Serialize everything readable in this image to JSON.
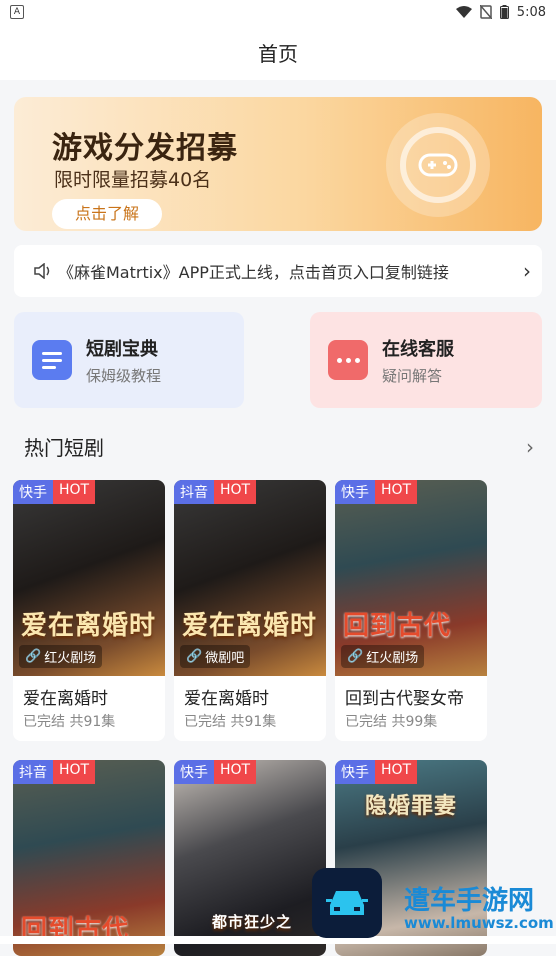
{
  "status_bar": {
    "left_icon": "A",
    "time": "5:08"
  },
  "header": {
    "title": "首页"
  },
  "banner": {
    "title": "游戏分发招募",
    "subtitle": "限时限量招募40名",
    "cta": "点击了解"
  },
  "notice": {
    "text": "《麻雀Matrtix》APP正式上线，点击首页入口复制链接"
  },
  "quick_cards": [
    {
      "title": "短剧宝典",
      "subtitle": "保姆级教程"
    },
    {
      "title": "在线客服",
      "subtitle": "疑问解答"
    }
  ],
  "section": {
    "title": "热门短剧"
  },
  "dramas": [
    {
      "platform": "快手",
      "hot": "HOT",
      "source": "红火剧场",
      "overlay": "爱在离婚时",
      "title": "爱在离婚时",
      "meta": "已完结 共91集"
    },
    {
      "platform": "抖音",
      "hot": "HOT",
      "source": "微剧吧",
      "overlay": "爱在离婚时",
      "title": "爱在离婚时",
      "meta": "已完结 共91集"
    },
    {
      "platform": "快手",
      "hot": "HOT",
      "source": "红火剧场",
      "overlay": "回到古代",
      "title": "回到古代娶女帝",
      "meta": "已完结 共99集"
    },
    {
      "platform": "抖音",
      "hot": "HOT",
      "source": "",
      "overlay": "回到古代",
      "title": "",
      "meta": ""
    },
    {
      "platform": "快手",
      "hot": "HOT",
      "source": "",
      "overlay": "都市狂少之",
      "title": "",
      "meta": ""
    },
    {
      "platform": "快手",
      "hot": "HOT",
      "source": "",
      "overlay": "隐婚罪妻",
      "title": "",
      "meta": ""
    }
  ],
  "watermark": {
    "name": "遣车手游网",
    "url": "www.lmuwsz.com"
  }
}
